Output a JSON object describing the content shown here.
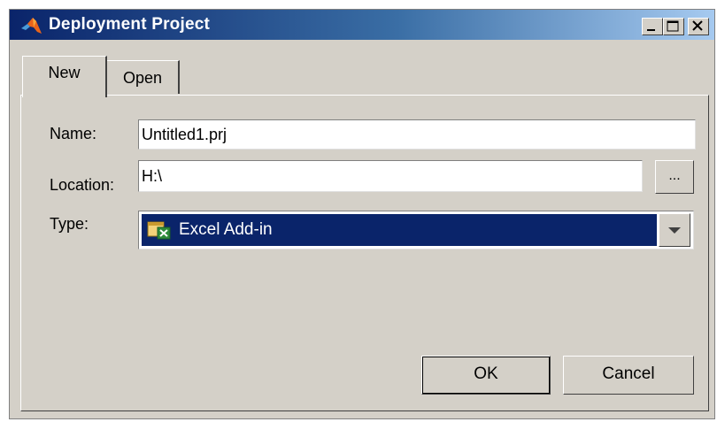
{
  "window": {
    "title": "Deployment Project",
    "controls": {
      "minimize": "minimize-icon",
      "maximize": "maximize-icon",
      "close": "close-icon"
    }
  },
  "tabs": [
    {
      "label": "New",
      "selected": true
    },
    {
      "label": "Open",
      "selected": false
    }
  ],
  "form": {
    "name_label": "Name:",
    "name_value": "Untitled1.prj",
    "location_label": "Location:",
    "location_value": "H:\\",
    "browse_label": "...",
    "type_label": "Type:",
    "type_value": "Excel Add-in",
    "type_icon": "excel-add-in-icon"
  },
  "buttons": {
    "ok": "OK",
    "cancel": "Cancel"
  },
  "colors": {
    "selection": "#0a246a",
    "face": "#d4d0c8",
    "title_start": "#0a246a",
    "title_end": "#a6caf0"
  }
}
